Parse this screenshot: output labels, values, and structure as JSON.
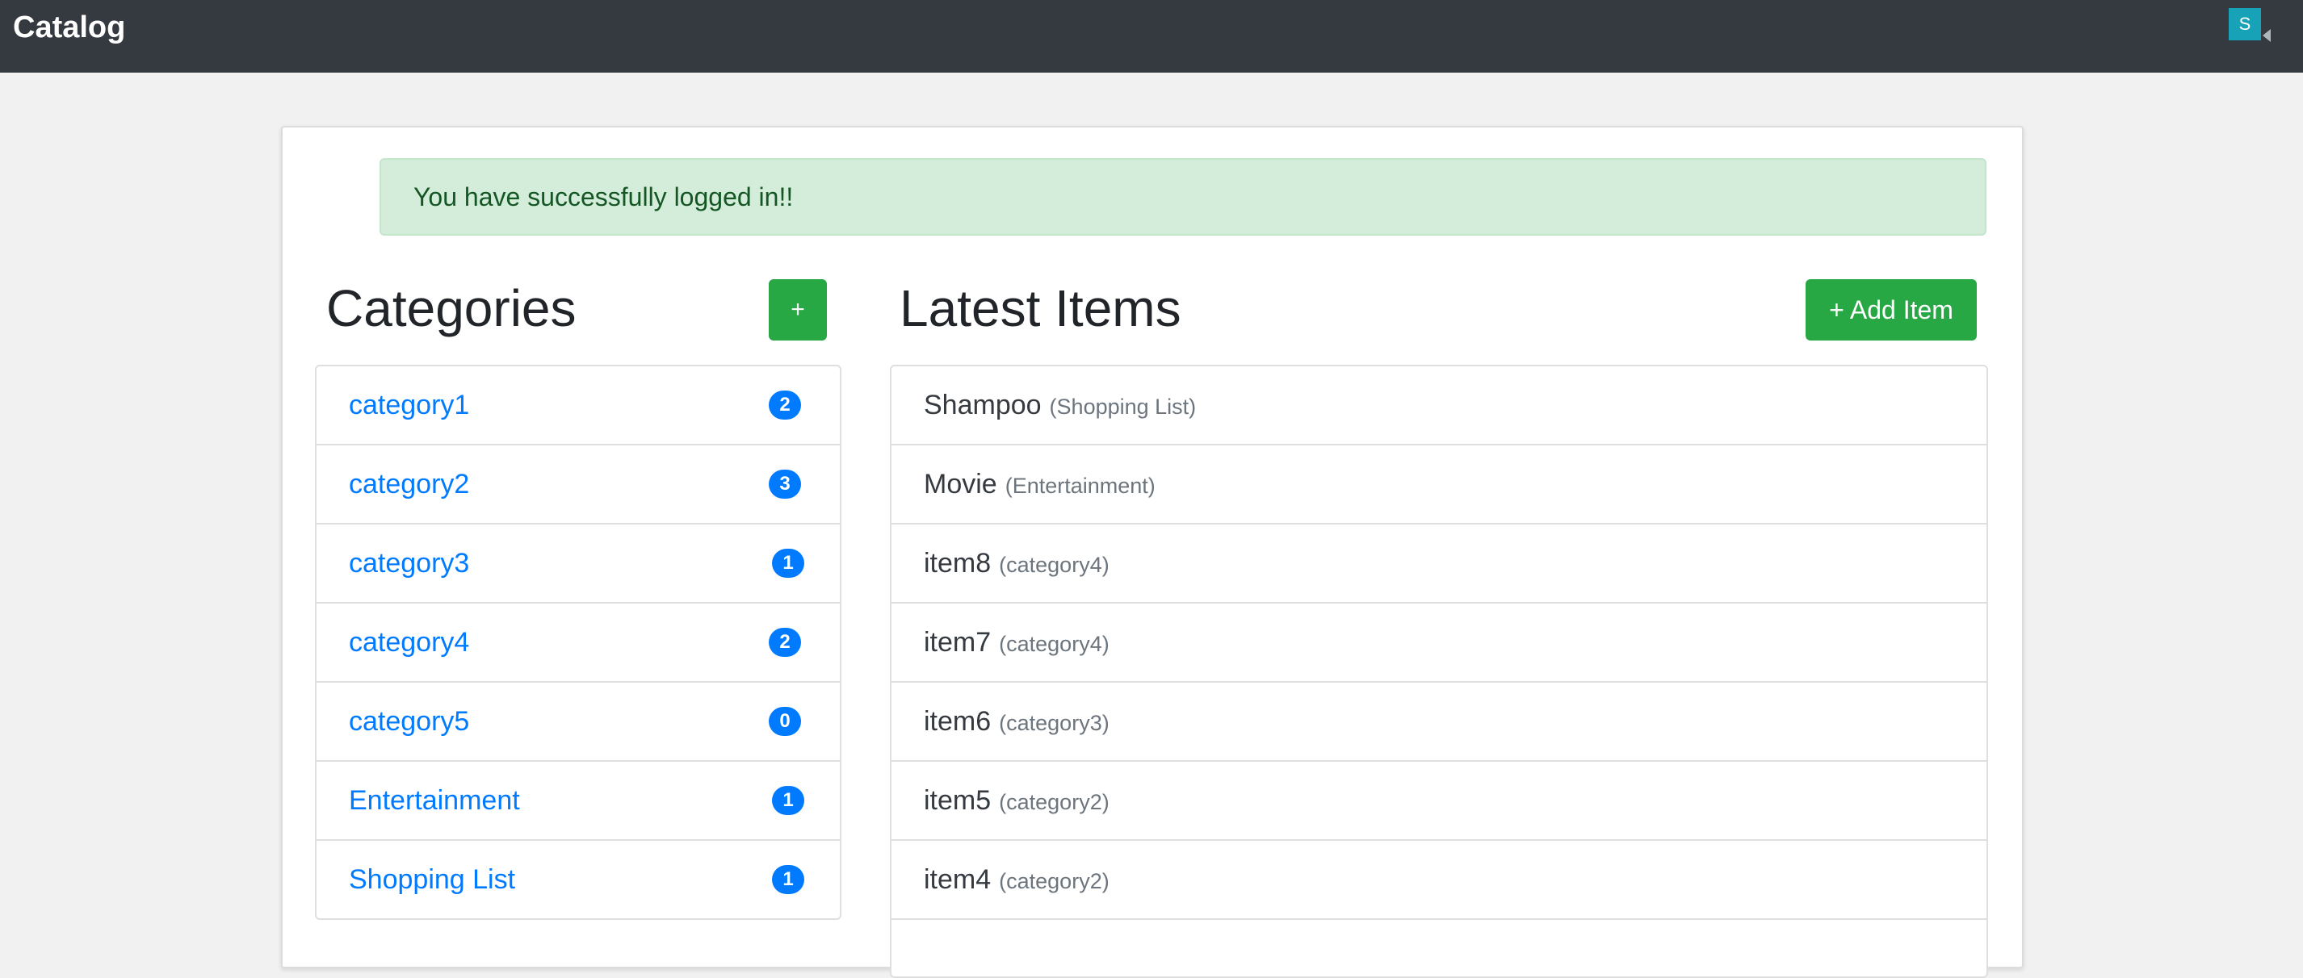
{
  "navbar": {
    "brand": "Catalog",
    "user_initial": "S"
  },
  "alert": {
    "message": "You have successfully logged in!!"
  },
  "categories": {
    "title": "Categories",
    "add_label": "+",
    "items": [
      {
        "name": "category1",
        "count": "2"
      },
      {
        "name": "category2",
        "count": "3"
      },
      {
        "name": "category3",
        "count": "1"
      },
      {
        "name": "category4",
        "count": "2"
      },
      {
        "name": "category5",
        "count": "0"
      },
      {
        "name": "Entertainment",
        "count": "1"
      },
      {
        "name": "Shopping List",
        "count": "1"
      }
    ]
  },
  "latest": {
    "title": "Latest Items",
    "add_label": "+ Add Item",
    "items": [
      {
        "name": "Shampoo",
        "category": "(Shopping List)"
      },
      {
        "name": "Movie",
        "category": "(Entertainment)"
      },
      {
        "name": "item8",
        "category": "(category4)"
      },
      {
        "name": "item7",
        "category": "(category4)"
      },
      {
        "name": "item6",
        "category": "(category3)"
      },
      {
        "name": "item5",
        "category": "(category2)"
      },
      {
        "name": "item4",
        "category": "(category2)"
      }
    ]
  },
  "colors": {
    "navbar": "#343a40",
    "link": "#007bff",
    "success": "#28a745",
    "alert_bg": "#d4edda",
    "alert_text": "#155724",
    "avatar": "#17a2b8"
  }
}
